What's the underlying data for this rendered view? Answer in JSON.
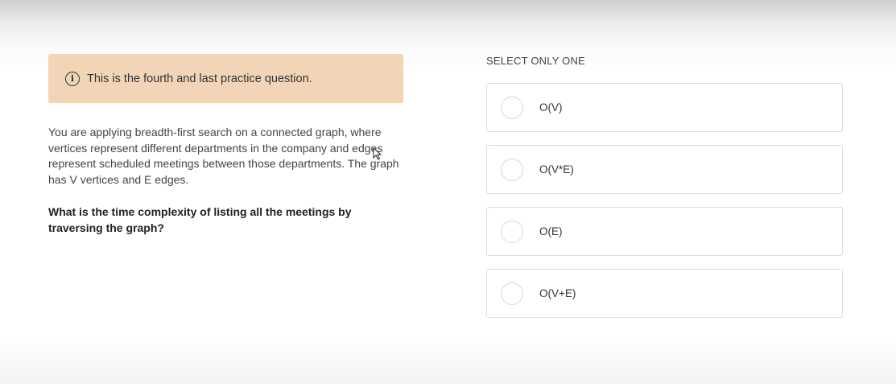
{
  "notice": {
    "icon": "info-circle-icon",
    "text": "This is the fourth and last practice question."
  },
  "question": {
    "body": "You are applying breadth-first search on a connected graph, where vertices represent different departments in the company and edges represent scheduled meetings between those departments. The graph has V vertices and E edges.",
    "prompt": "What is the time complexity of listing all the meetings by traversing the graph?"
  },
  "answers": {
    "instruction": "SELECT ONLY ONE",
    "options": [
      {
        "label": "O(V)",
        "selected": false
      },
      {
        "label": "O(V*E)",
        "selected": false
      },
      {
        "label": "O(E)",
        "selected": false
      },
      {
        "label": "O(V+E)",
        "selected": false
      }
    ]
  },
  "colors": {
    "notice_bg": "#f2d5b6",
    "option_border": "#dcdcdc",
    "text": "#333333"
  }
}
